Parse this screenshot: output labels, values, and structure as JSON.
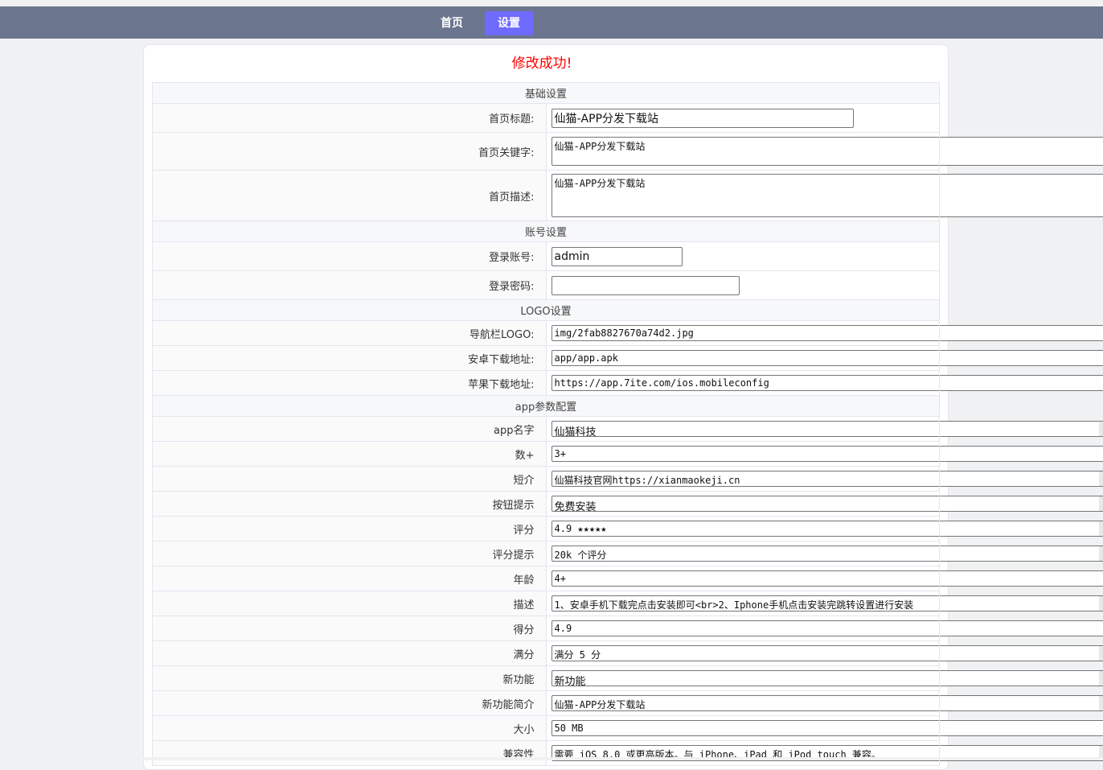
{
  "nav": {
    "home_label": "首页",
    "settings_label": "设置",
    "active_color": "#6f6bff",
    "bar_color": "#6b758e"
  },
  "message": "修改成功!",
  "sections": {
    "basic": "基础设置",
    "account": "账号设置",
    "logo": "LOGO设置",
    "app": "app参数配置"
  },
  "basic": {
    "title_label": "首页标题:",
    "title_value": "仙猫-APP分发下载站",
    "keywords_label": "首页关键字:",
    "keywords_value": "仙猫-APP分发下载站",
    "desc_label": "首页描述:",
    "desc_value": "仙猫-APP分发下载站"
  },
  "account": {
    "username_label": "登录账号:",
    "username_value": "admin",
    "password_label": "登录密码:",
    "password_value": ""
  },
  "logo": {
    "nav_logo_label": "导航栏LOGO:",
    "nav_logo_value": "img/2fab8827670a74d2.jpg",
    "android_label": "安卓下载地址:",
    "android_value": "app/app.apk",
    "ios_label": "苹果下载地址:",
    "ios_value": "https://app.7ite.com/ios.mobileconfig"
  },
  "app": {
    "name_label": "app名字",
    "name_value": "仙猫科技",
    "count_label": "数+",
    "count_value": "3+",
    "intro_label": "短介",
    "intro_value": "仙猫科技官网https://xianmaokeji.cn",
    "button_label": "按钮提示",
    "button_value": "免费安装",
    "rating_label": "评分",
    "rating_value": "4.9 ★★★★★",
    "rating_tip_label": "评分提示",
    "rating_tip_value": "20k 个评分",
    "age_label": "年龄",
    "age_value": "4+",
    "desc_label": "描述",
    "desc_value": "1、安卓手机下载完点击安装即可<br>2、Iphone手机点击安装完跳转设置进行安装",
    "score_label": "得分",
    "score_value": "4.9",
    "full_label": "满分",
    "full_value": "满分 5 分",
    "feature_label": "新功能",
    "feature_value": "新功能",
    "feature_intro_label": "新功能简介",
    "feature_intro_value": "仙猫-APP分发下载站",
    "size_label": "大小",
    "size_value": "50 MB",
    "compat_label": "兼容性",
    "compat_value": "需要 iOS 8.0 或更高版本。与 iPhone、iPad 和 iPod touch 兼容。"
  }
}
